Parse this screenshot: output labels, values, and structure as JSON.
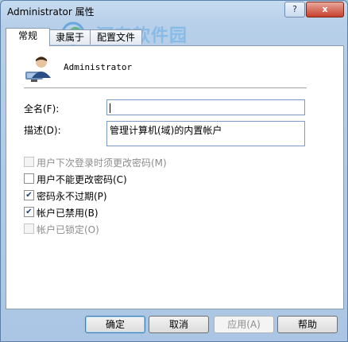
{
  "window": {
    "title": "Administrator 属性",
    "help_glyph": "?",
    "close_glyph": "x"
  },
  "watermark": {
    "title": "河东软件园",
    "url": "www.pc0359.cn"
  },
  "tabs": [
    {
      "label": "常规"
    },
    {
      "label": "隶属于"
    },
    {
      "label": "配置文件"
    }
  ],
  "user": {
    "name": "Administrator"
  },
  "fields": {
    "fullname_label": "全名(F):",
    "fullname_value": "",
    "description_label": "描述(D):",
    "description_value": "管理计算机(域)的内置帐户"
  },
  "checkboxes": [
    {
      "label": "用户下次登录时须更改密码(M)",
      "checked": false,
      "enabled": false
    },
    {
      "label": "用户不能更改密码(C)",
      "checked": false,
      "enabled": true
    },
    {
      "label": "密码永不过期(P)",
      "checked": true,
      "enabled": true
    },
    {
      "label": "帐户已禁用(B)",
      "checked": true,
      "enabled": true
    },
    {
      "label": "帐户已锁定(O)",
      "checked": false,
      "enabled": false
    }
  ],
  "buttons": {
    "ok": "确定",
    "cancel": "取消",
    "apply": "应用(A)",
    "help": "帮助"
  }
}
